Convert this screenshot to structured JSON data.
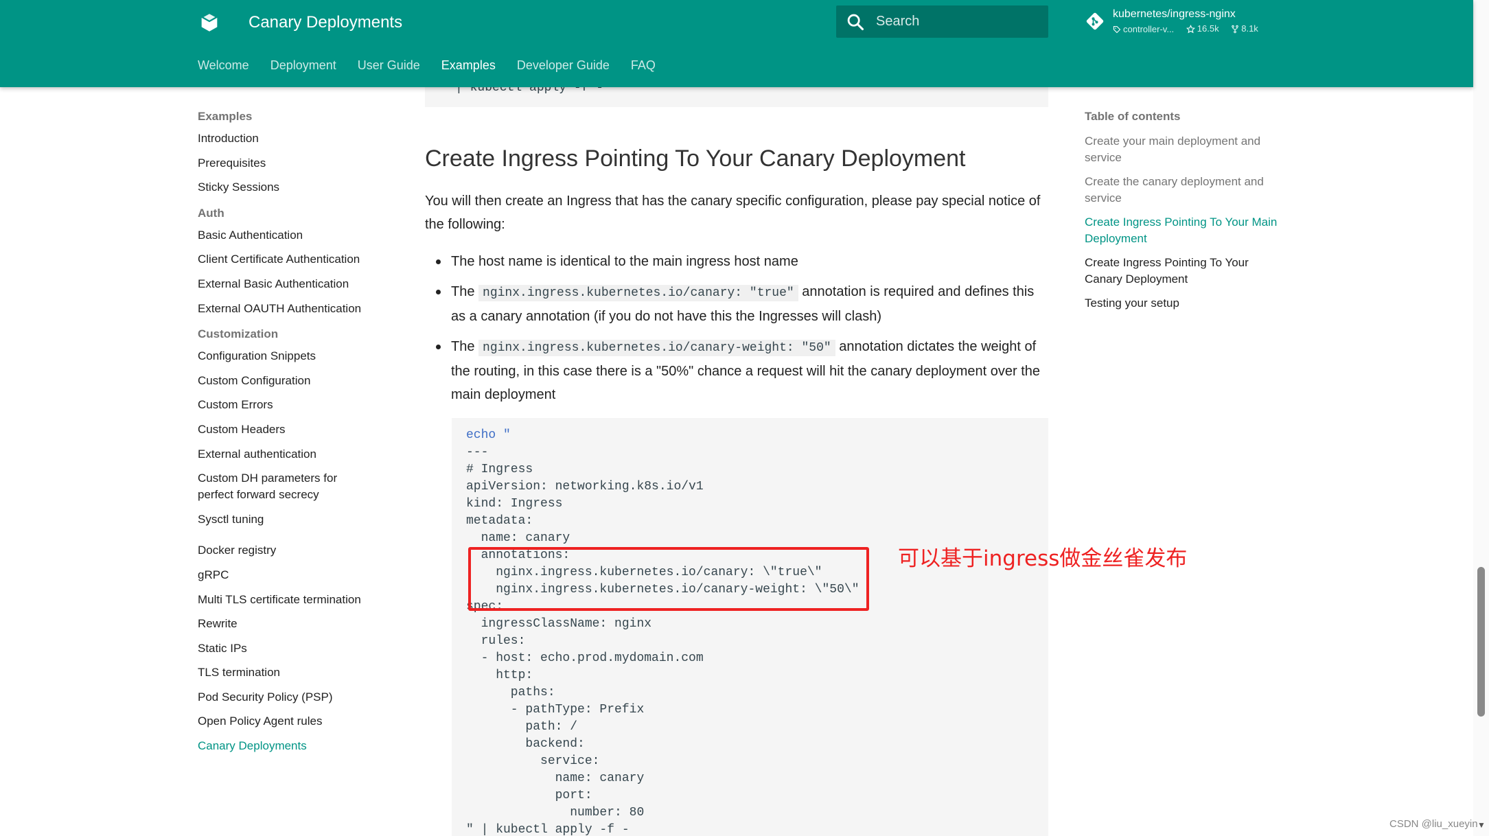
{
  "header": {
    "title": "Canary Deployments",
    "search_placeholder": "Search",
    "repo": {
      "name": "kubernetes/ingress-nginx",
      "version": "controller-v...",
      "stars": "16.5k",
      "forks": "8.1k"
    },
    "tabs": [
      "Welcome",
      "Deployment",
      "User Guide",
      "Examples",
      "Developer Guide",
      "FAQ"
    ],
    "active_tab": "Examples"
  },
  "nav": {
    "sections": [
      {
        "title": "Examples",
        "items": [
          "Introduction",
          "Prerequisites",
          "Sticky Sessions"
        ]
      },
      {
        "title": "Auth",
        "items": [
          "Basic Authentication",
          "Client Certificate Authentication",
          "External Basic Authentication",
          "External OAUTH Authentication"
        ]
      },
      {
        "title": "Customization",
        "items": [
          "Configuration Snippets",
          "Custom Configuration",
          "Custom Errors",
          "Custom Headers",
          "External authentication",
          "Custom DH parameters for perfect forward secrecy",
          "Sysctl tuning"
        ]
      },
      {
        "title": "",
        "items": [
          "Docker registry",
          "gRPC",
          "Multi TLS certificate termination",
          "Rewrite",
          "Static IPs",
          "TLS termination",
          "Pod Security Policy (PSP)",
          "Open Policy Agent rules",
          "Canary Deployments"
        ]
      }
    ],
    "active_item": "Canary Deployments"
  },
  "main": {
    "code_top": "| kubectl apply -f -",
    "heading": "Create Ingress Pointing To Your Canary Deployment",
    "paragraph": "You will then create an Ingress that has the canary specific configuration, please pay special notice of the following:",
    "bullet1": "The host name is identical to the main ingress host name",
    "bullet2_pre": "The ",
    "bullet2_code": "nginx.ingress.kubernetes.io/canary: \"true\"",
    "bullet2_post": " annotation is required and defines this as a canary annotation (if you do not have this the Ingresses will clash)",
    "bullet3_pre": "The ",
    "bullet3_code": "nginx.ingress.kubernetes.io/canary-weight: \"50\"",
    "bullet3_post": " annotation dictates the weight of the routing, in this case there is a \"50%\" chance a request will hit the canary deployment over the main deployment",
    "code_lines": [
      "echo \"",
      "---",
      "# Ingress",
      "apiVersion: networking.k8s.io/v1",
      "kind: Ingress",
      "metadata:",
      "  name: canary",
      "  annotations:",
      "    nginx.ingress.kubernetes.io/canary: \\\"true\\\"",
      "    nginx.ingress.kubernetes.io/canary-weight: \\\"50\\\"",
      "spec:",
      "  ingressClassName: nginx",
      "  rules:",
      "  - host: echo.prod.mydomain.com",
      "    http:",
      "      paths:",
      "      - pathType: Prefix",
      "        path: /",
      "        backend:",
      "          service:",
      "            name: canary",
      "            port:",
      "              number: 80",
      "\" | kubectl apply -f -"
    ],
    "annotation_text": "可以基于ingress做金丝雀发布"
  },
  "toc": {
    "title": "Table of contents",
    "items": [
      "Create your main deployment and service",
      "Create the canary deployment and service",
      "Create Ingress Pointing To Your Main Deployment",
      "Create Ingress Pointing To Your Canary Deployment",
      "Testing your setup"
    ]
  },
  "watermark": "CSDN @liu_xueyin",
  "colors": {
    "header_bg": "#009485",
    "accent": "#009485",
    "annotation_red": "#ee2222",
    "code_bg": "#f5f5f5"
  },
  "icons": {
    "logo": "book-icon",
    "search": "search-icon",
    "repo": "git-icon",
    "tag": "tag-icon",
    "star": "star-icon",
    "fork": "fork-icon"
  }
}
